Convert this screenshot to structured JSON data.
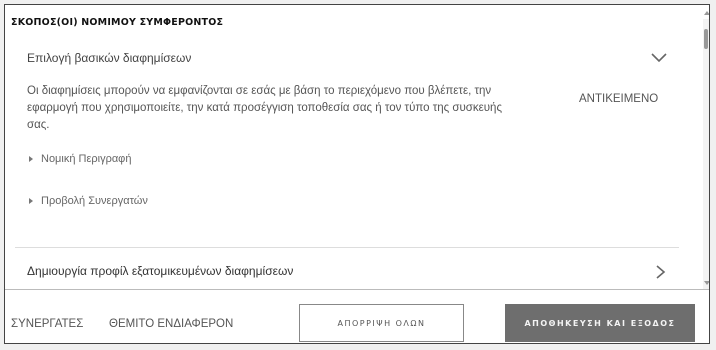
{
  "header": {
    "title": "ΣΚΟΠΟΣ(ΟΙ) ΝΟΜΙΜΟΥ ΣΥΜΦΕΡΟΝΤΟΣ"
  },
  "purposes": [
    {
      "title": "Επιλογή βασικών διαφημίσεων",
      "expanded": true,
      "icon": "chevron-down-icon",
      "description": "Οι διαφημίσεις μπορούν να εμφανίζονται σε εσάς με βάση το περιεχόμενο που βλέπετε, την εφαρμογή που χρησιμοποιείτε, την κατά προσέγγιση τοποθεσία σας ή τον τύπο της συσκευής σας.",
      "status": "ΑΝΤΙΚΕΙΜΕΝΟ",
      "links": [
        {
          "label": "Νομική Περιγραφή",
          "icon": "triangle-right-icon"
        },
        {
          "label": "Προβολή Συνεργατών",
          "icon": "triangle-right-icon"
        }
      ]
    },
    {
      "title": "Δημιουργία προφίλ εξατομικευμένων διαφημίσεων",
      "expanded": false,
      "icon": "chevron-right-icon"
    }
  ],
  "footer": {
    "partners_link": "ΣΥΝΕΡΓΑΤΕΣ",
    "legit_interest_link": "ΘΕΜΙΤΟ ΕΝΔΙΑΦΕΡΟΝ",
    "reject_all": "ΑΠΟΡΡΙΨΗ ΟΛΩΝ",
    "save_exit": "ΑΠΟΘΗΚΕΥΣΗ ΚΑΙ ΕΞΟΔΟΣ"
  },
  "colors": {
    "primary_button": "#6e6e6e",
    "border": "#444444",
    "text": "#555555"
  }
}
